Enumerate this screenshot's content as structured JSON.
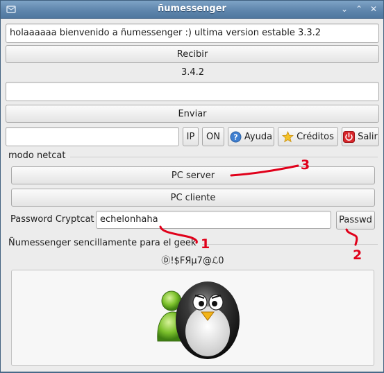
{
  "window": {
    "title": "ñumessenger",
    "minimize_glyph": "⌄",
    "maximize_glyph": "⌃",
    "close_glyph": "✕"
  },
  "received_text": "holaaaaaa bienvenido a ñumessenger :) ultima version estable 3.3.2",
  "recibir_label": "Recibir",
  "version_label": "3.4.2",
  "send_text": "",
  "enviar_label": "Enviar",
  "ip_input_value": "",
  "toolbar": {
    "ip_label": "IP",
    "on_label": "ON",
    "ayuda_label": "Ayuda",
    "creditos_label": "Créditos",
    "salir_label": "Salir"
  },
  "netcat": {
    "group_title": "modo netcat",
    "pc_server_label": "PC server",
    "pc_cliente_label": "PC cliente",
    "password_label": "Password Cryptcat",
    "password_value": "echelonhaha",
    "passwd_button_label": "Passwd"
  },
  "footer": {
    "group_title": "Ñumessenger sencillamente para el geek",
    "cipher_text": "Ⓓ!$FЯµ7@ℒ0"
  },
  "annotations": {
    "mark_1": "1",
    "mark_2": "2",
    "mark_3": "3",
    "color": "#e0001a"
  },
  "icons": {
    "ayuda": "help-icon",
    "creditos": "star-icon",
    "salir": "power-icon",
    "mascot": "penguin-mascot"
  }
}
